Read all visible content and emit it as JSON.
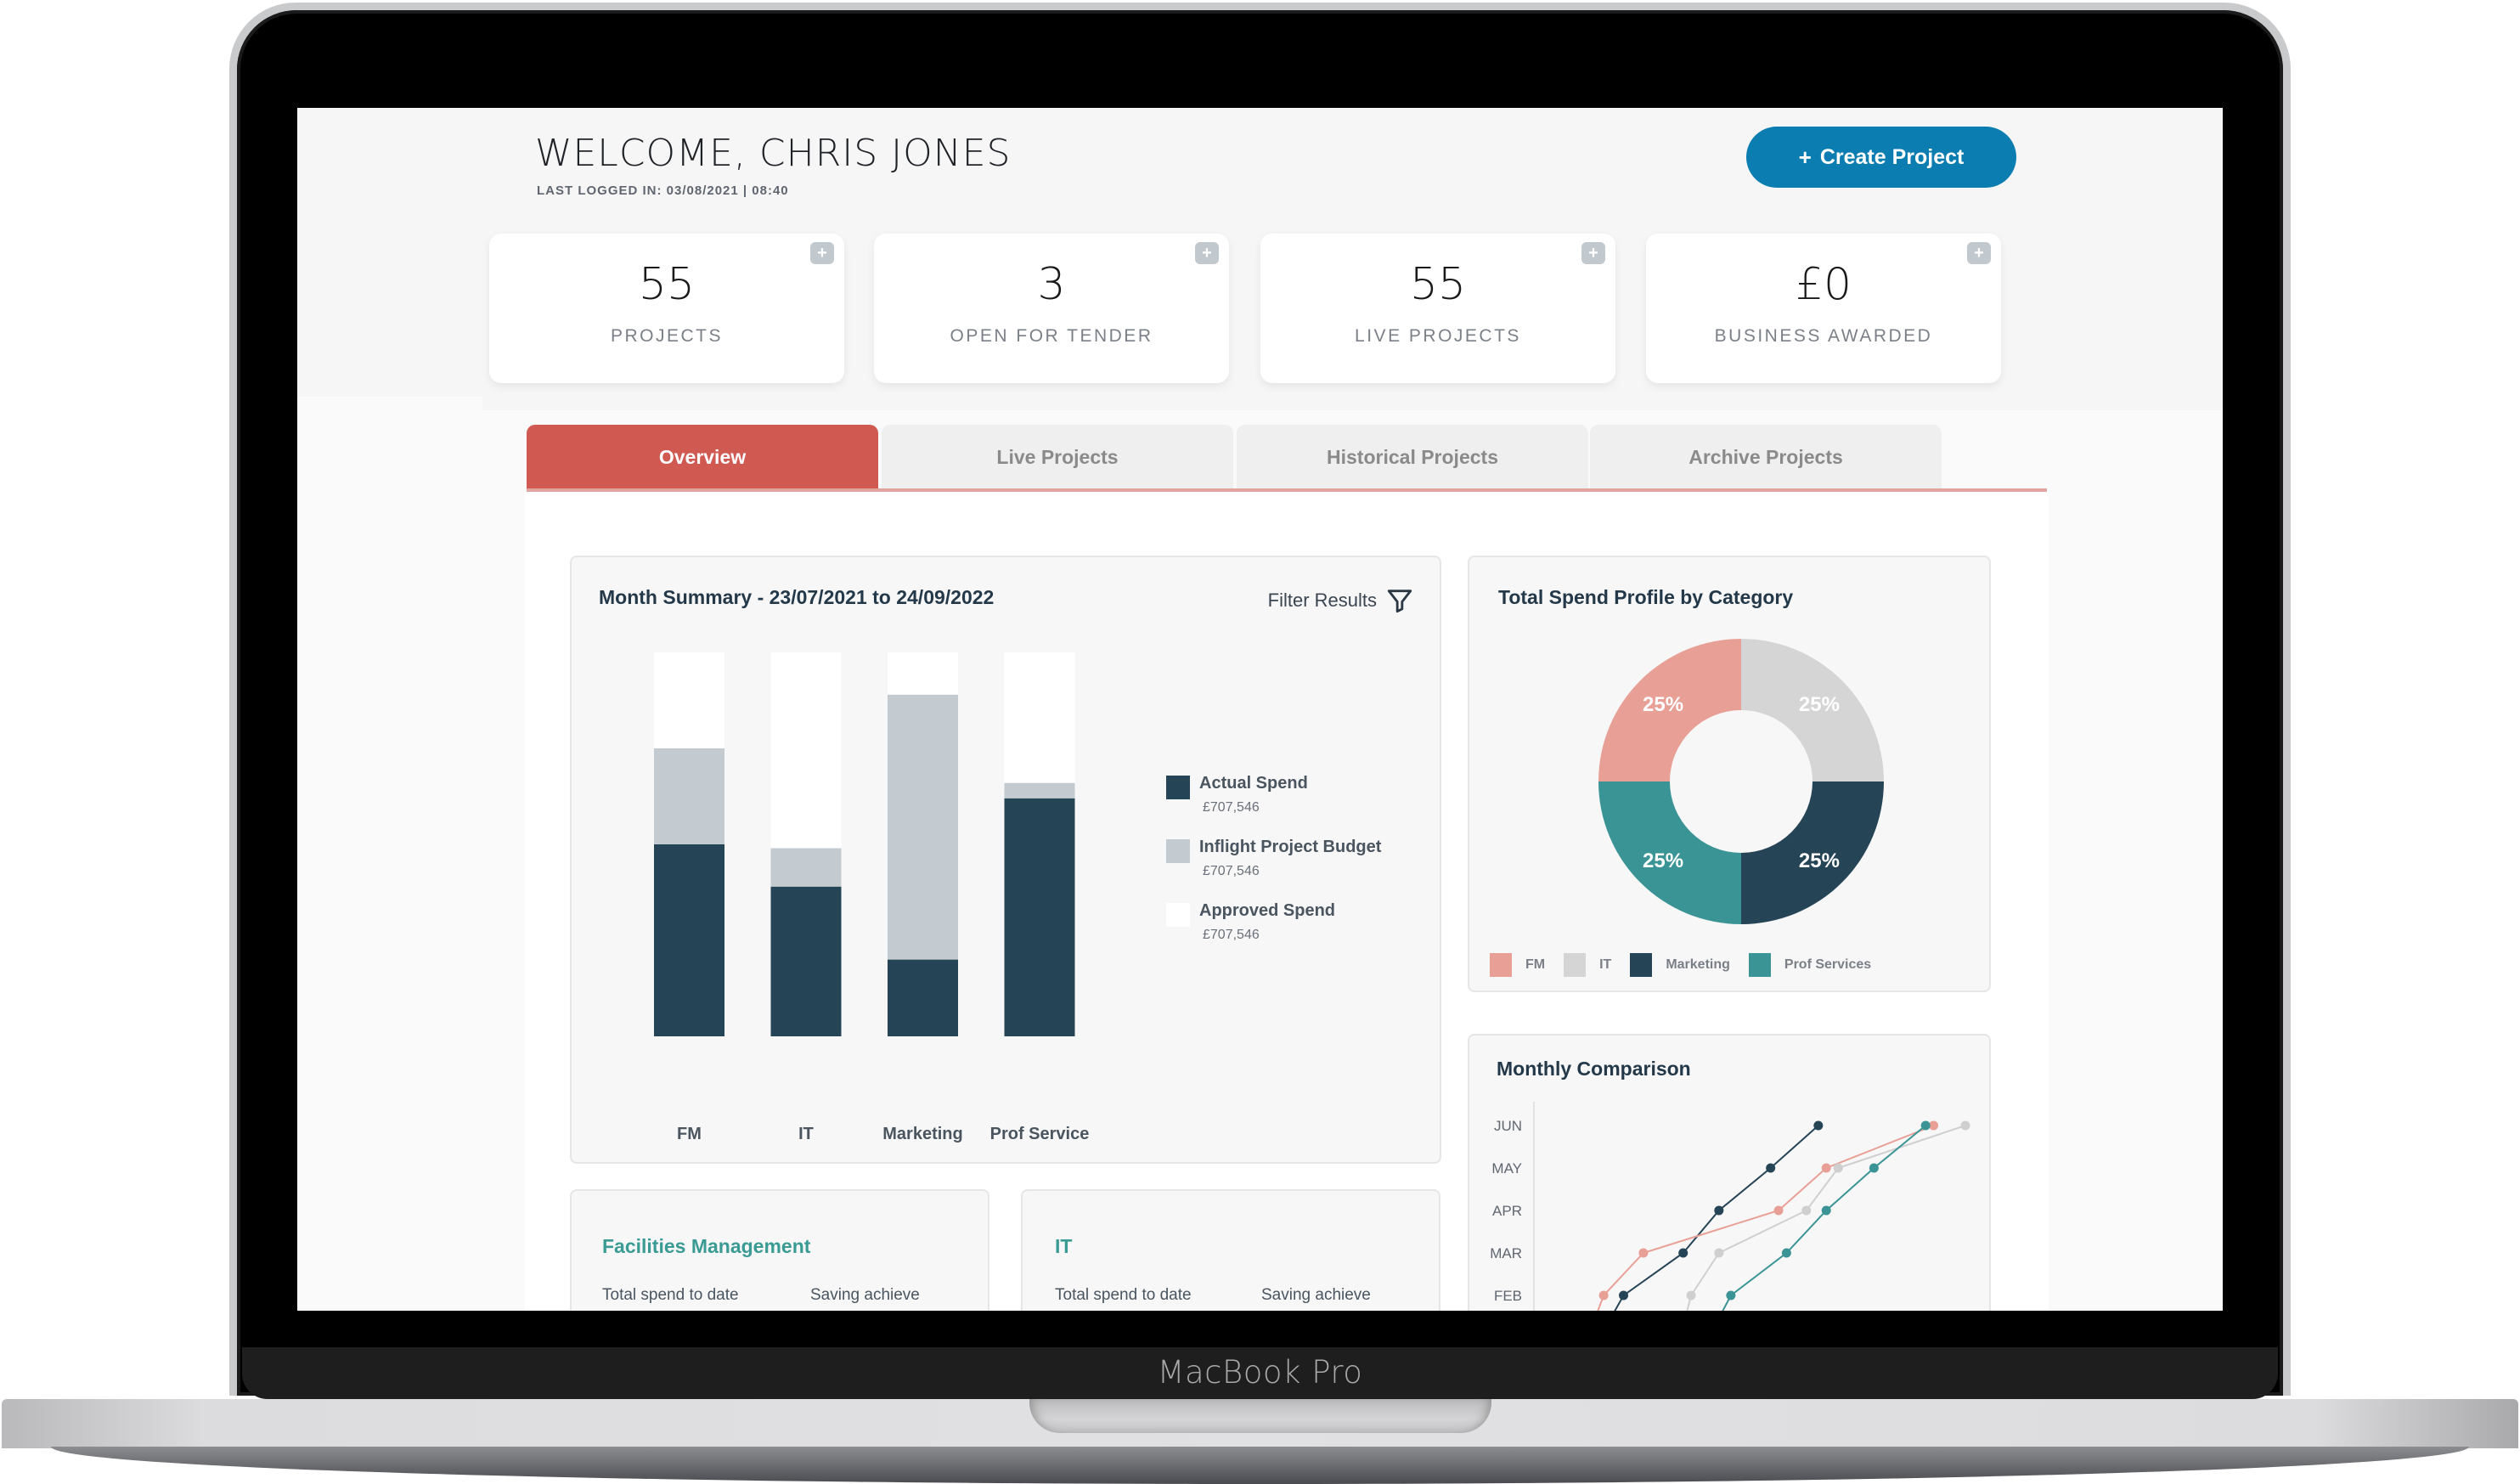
{
  "device": {
    "label": "MacBook Pro"
  },
  "header": {
    "welcome": "WELCOME, CHRIS JONES",
    "last_logged": "LAST LOGGED IN: 03/08/2021 | 08:40",
    "create_button": {
      "icon": "+",
      "label": "Create Project"
    }
  },
  "stats": [
    {
      "value": "55",
      "label": "PROJECTS",
      "add_icon": "+"
    },
    {
      "value": "3",
      "label": "OPEN FOR TENDER",
      "add_icon": "+"
    },
    {
      "value": "55",
      "label": "LIVE PROJECTS",
      "add_icon": "+"
    },
    {
      "value": "£0",
      "label": "BUSINESS AWARDED",
      "add_icon": "+"
    }
  ],
  "tabs": [
    {
      "label": "Overview",
      "active": true
    },
    {
      "label": "Live Projects",
      "active": false
    },
    {
      "label": "Historical Projects",
      "active": false
    },
    {
      "label": "Archive Projects",
      "active": false
    }
  ],
  "colors": {
    "accent": "#0b7db1",
    "tab_active": "#d05a51",
    "actual": "#254456",
    "inflight": "#c3cbd1",
    "approved": "#ffffff",
    "fm": "#e8a096",
    "it": "#d5d5d5",
    "marketing": "#254456",
    "prof": "#3a9496"
  },
  "month_summary": {
    "title": "Month Summary - 23/07/2021 to 24/09/2022",
    "filter_label": "Filter Results"
  },
  "bottom_cards": [
    {
      "title": "Facilities Management",
      "col1": "Total spend to date",
      "col2": "Saving achieve"
    },
    {
      "title": "IT",
      "col1": "Total spend to date",
      "col2": "Saving achieve"
    }
  ],
  "chart_data": [
    {
      "type": "bar",
      "stacked": true,
      "title": "Month Summary - 23/07/2021 to 24/09/2022",
      "categories": [
        "FM",
        "IT",
        "Marketing",
        "Prof Service"
      ],
      "series": [
        {
          "name": "Actual Spend",
          "amount": "£707,546",
          "color": "#254456",
          "values": [
            0.5,
            0.39,
            0.2,
            0.62
          ]
        },
        {
          "name": "Inflight Project Budget",
          "amount": "£707,546",
          "color": "#c3cbd1",
          "values": [
            0.25,
            0.1,
            0.69,
            0.04
          ]
        },
        {
          "name": "Approved Spend",
          "amount": "£707,546",
          "color": "#ffffff",
          "values": [
            0.25,
            0.51,
            0.11,
            0.34
          ]
        }
      ],
      "ylim": [
        0,
        1
      ],
      "legend": "right"
    },
    {
      "type": "pie",
      "donut": true,
      "title": "Total Spend Profile by Category",
      "slices": [
        {
          "label": "FM",
          "value": 25,
          "text": "25%",
          "color": "#e8a096"
        },
        {
          "label": "IT",
          "value": 25,
          "text": "25%",
          "color": "#d5d5d5"
        },
        {
          "label": "Marketing",
          "value": 25,
          "text": "25%",
          "color": "#254456"
        },
        {
          "label": "Prof Services",
          "value": 25,
          "text": "25%",
          "color": "#3a9496"
        }
      ],
      "legend": "bottom"
    },
    {
      "type": "line",
      "title": "Monthly Comparison",
      "y_categories": [
        "FEB",
        "MAR",
        "APR",
        "MAY",
        "JUN"
      ],
      "xlim": [
        0,
        100
      ],
      "series": [
        {
          "name": "Marketing",
          "color": "#254456",
          "x": [
            14,
            29,
            38,
            51,
            63
          ]
        },
        {
          "name": "FM",
          "color": "#e8a096",
          "x": [
            9,
            19,
            53,
            65,
            92
          ]
        },
        {
          "name": "IT",
          "color": "#cfcfcf",
          "x": [
            31,
            38,
            60,
            68,
            100
          ]
        },
        {
          "name": "Prof Services",
          "color": "#3a9496",
          "x": [
            41,
            55,
            65,
            77,
            90
          ]
        }
      ]
    }
  ]
}
